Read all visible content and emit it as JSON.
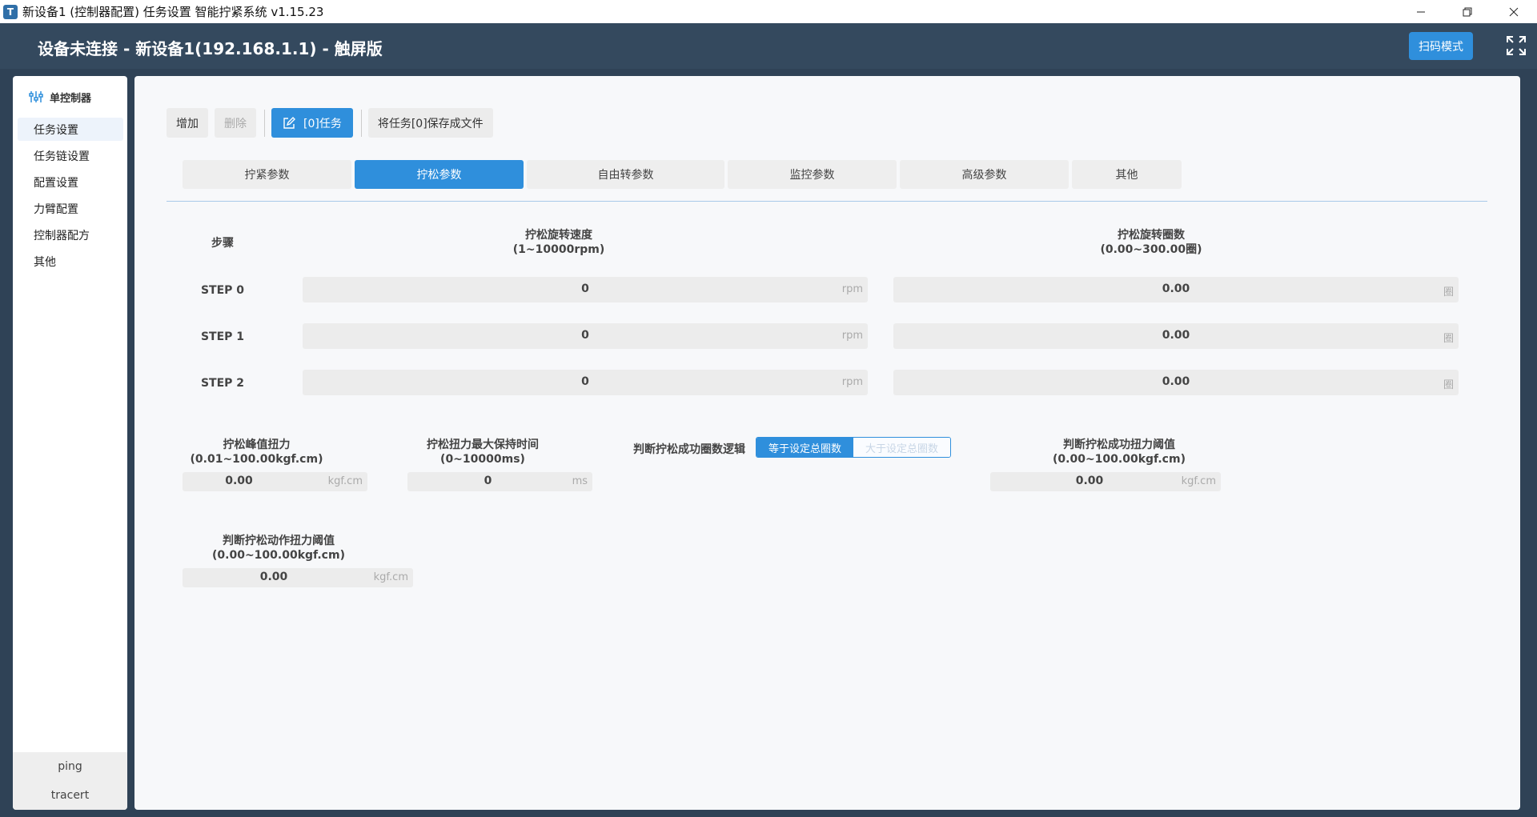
{
  "window": {
    "title": "新设备1 (控制器配置) 任务设置 智能拧紧系统 v1.15.23",
    "icon_text": "T",
    "controls": [
      "minimize-icon",
      "restore-icon",
      "close-icon"
    ]
  },
  "header": {
    "title": "设备未连接 - 新设备1(192.168.1.1) - 触屏版",
    "scan_button": "扫码模式"
  },
  "sidebar": {
    "heading": "单控制器",
    "items": [
      {
        "label": "任务设置",
        "active": true
      },
      {
        "label": "任务链设置",
        "active": false
      },
      {
        "label": "配置设置",
        "active": false
      },
      {
        "label": "力臂配置",
        "active": false
      },
      {
        "label": "控制器配方",
        "active": false
      },
      {
        "label": "其他",
        "active": false
      }
    ],
    "footer": [
      "ping",
      "tracert"
    ]
  },
  "toolbar": {
    "add": "增加",
    "delete": "删除",
    "task": "[0]任务",
    "save": "将任务[0]保存成文件"
  },
  "tabs": [
    {
      "label": "拧紧参数",
      "active": false
    },
    {
      "label": "拧松参数",
      "active": true
    },
    {
      "label": "自由转参数",
      "active": false
    },
    {
      "label": "监控参数",
      "active": false
    },
    {
      "label": "高级参数",
      "active": false
    },
    {
      "label": "其他",
      "active": false
    }
  ],
  "steps_table": {
    "col_step": "步骤",
    "col_speed": "拧松旋转速度",
    "col_speed_range": "(1~10000rpm)",
    "col_turns": "拧松旋转圈数",
    "col_turns_range": "(0.00~300.00圈)",
    "rows": [
      {
        "label": "STEP 0",
        "speed": "0",
        "speed_unit": "rpm",
        "turns": "0.00",
        "turns_unit": "圈"
      },
      {
        "label": "STEP 1",
        "speed": "0",
        "speed_unit": "rpm",
        "turns": "0.00",
        "turns_unit": "圈"
      },
      {
        "label": "STEP 2",
        "speed": "0",
        "speed_unit": "rpm",
        "turns": "0.00",
        "turns_unit": "圈"
      }
    ]
  },
  "params": {
    "peak_torque": {
      "label": "拧松峰值扭力",
      "range": "(0.01~100.00kgf.cm)",
      "value": "0.00",
      "unit": "kgf.cm"
    },
    "hold_time": {
      "label": "拧松扭力最大保持时间",
      "range": "(0~10000ms)",
      "value": "0",
      "unit": "ms"
    },
    "logic": {
      "label": "判断拧松成功圈数逻辑",
      "option_a": "等于设定总圈数",
      "option_b": "大于设定总圈数"
    },
    "success_torque": {
      "label": "判断拧松成功扭力阈值",
      "range": "(0.00~100.00kgf.cm)",
      "value": "0.00",
      "unit": "kgf.cm"
    },
    "action_torque": {
      "label": "判断拧松动作扭力阈值",
      "range": "(0.00~100.00kgf.cm)",
      "value": "0.00",
      "unit": "kgf.cm"
    }
  },
  "colors": {
    "accent": "#2f8fdc",
    "header_bg": "#34495e"
  }
}
